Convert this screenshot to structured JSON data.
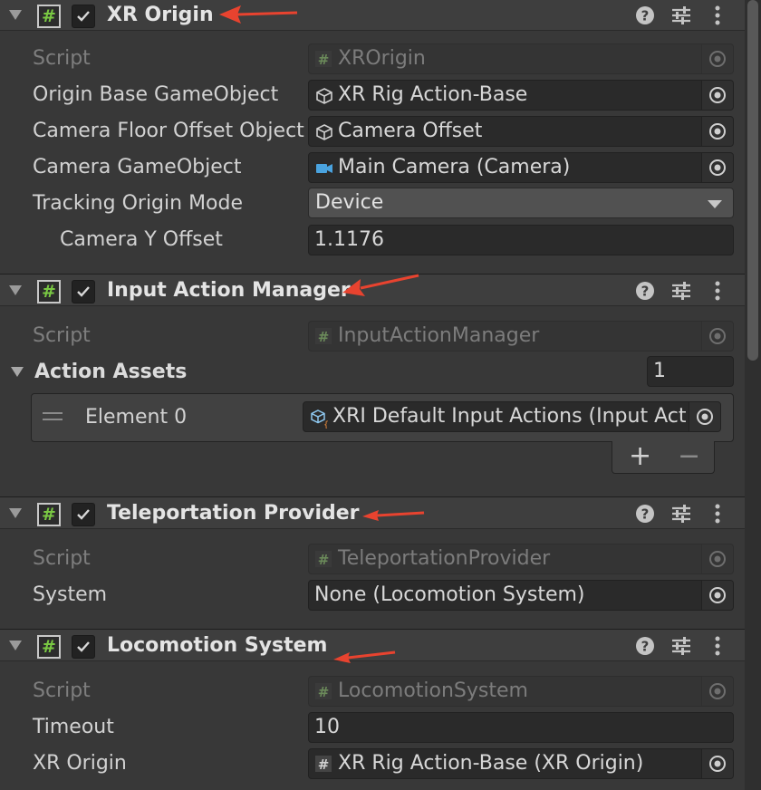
{
  "components": [
    {
      "title": "XR Origin",
      "rows": [
        {
          "label": "Script",
          "value": "XROrigin"
        },
        {
          "label": "Origin Base GameObject",
          "value": "XR Rig Action-Base"
        },
        {
          "label": "Camera Floor Offset Object",
          "value": "Camera Offset"
        },
        {
          "label": "Camera GameObject",
          "value": "Main Camera (Camera)"
        },
        {
          "label": "Tracking Origin Mode",
          "value": "Device"
        },
        {
          "label": "Camera Y Offset",
          "value": "1.1176"
        }
      ]
    },
    {
      "title": "Input Action Manager",
      "rows": [
        {
          "label": "Script",
          "value": "InputActionManager"
        },
        {
          "label": "Action Assets",
          "value": "1"
        },
        {
          "label": "Element 0",
          "value": "XRI Default Input Actions (Input Act"
        }
      ],
      "add_label": "+",
      "remove_label": "−"
    },
    {
      "title": "Teleportation Provider",
      "rows": [
        {
          "label": "Script",
          "value": "TeleportationProvider"
        },
        {
          "label": "System",
          "value": "None (Locomotion System)"
        }
      ]
    },
    {
      "title": "Locomotion System",
      "rows": [
        {
          "label": "Script",
          "value": "LocomotionSystem"
        },
        {
          "label": "Timeout",
          "value": "10"
        },
        {
          "label": "XR Origin",
          "value": "XR Rig Action-Base (XR Origin)"
        }
      ]
    }
  ],
  "header_icons": [
    "foldout-triangle-icon",
    "script-hash-icon",
    "enabled-checkbox",
    "help-icon",
    "preset-sliders-icon",
    "kebab-menu-icon"
  ],
  "colors": {
    "background": "#383838",
    "header": "#3e3e3e",
    "field": "#2a2a2a",
    "script_hash": "#7ac943",
    "annotation_arrow": "#e8432f"
  }
}
